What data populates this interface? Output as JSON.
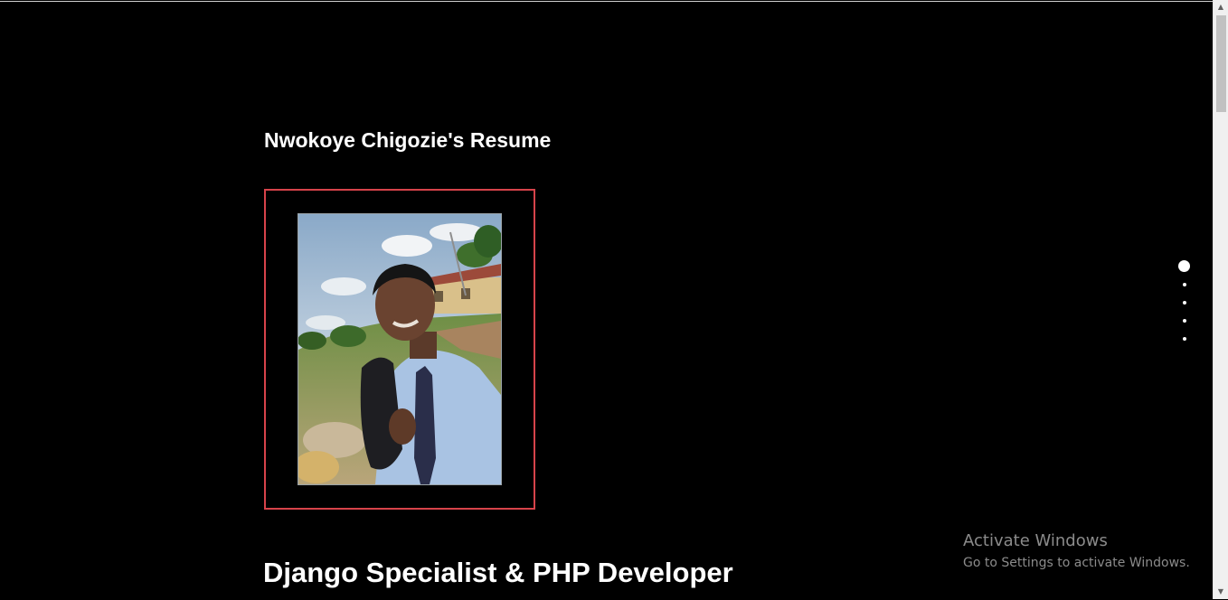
{
  "page": {
    "title": "Nwokoye Chigozie's Resume",
    "headline": "Django Specialist & PHP Developer"
  },
  "photo": {
    "alt": "Profile photo"
  },
  "section_nav": {
    "active_index": 0,
    "count": 5
  },
  "watermark": {
    "title": "Activate Windows",
    "subtitle": "Go to Settings to activate Windows."
  },
  "scrollbar": {
    "up_icon": "scroll-up-arrow-icon",
    "down_icon": "scroll-down-arrow-icon"
  },
  "colors": {
    "background": "#000000",
    "frame_border": "#d6434a",
    "text": "#ffffff",
    "watermark": "#8b8b8b"
  }
}
